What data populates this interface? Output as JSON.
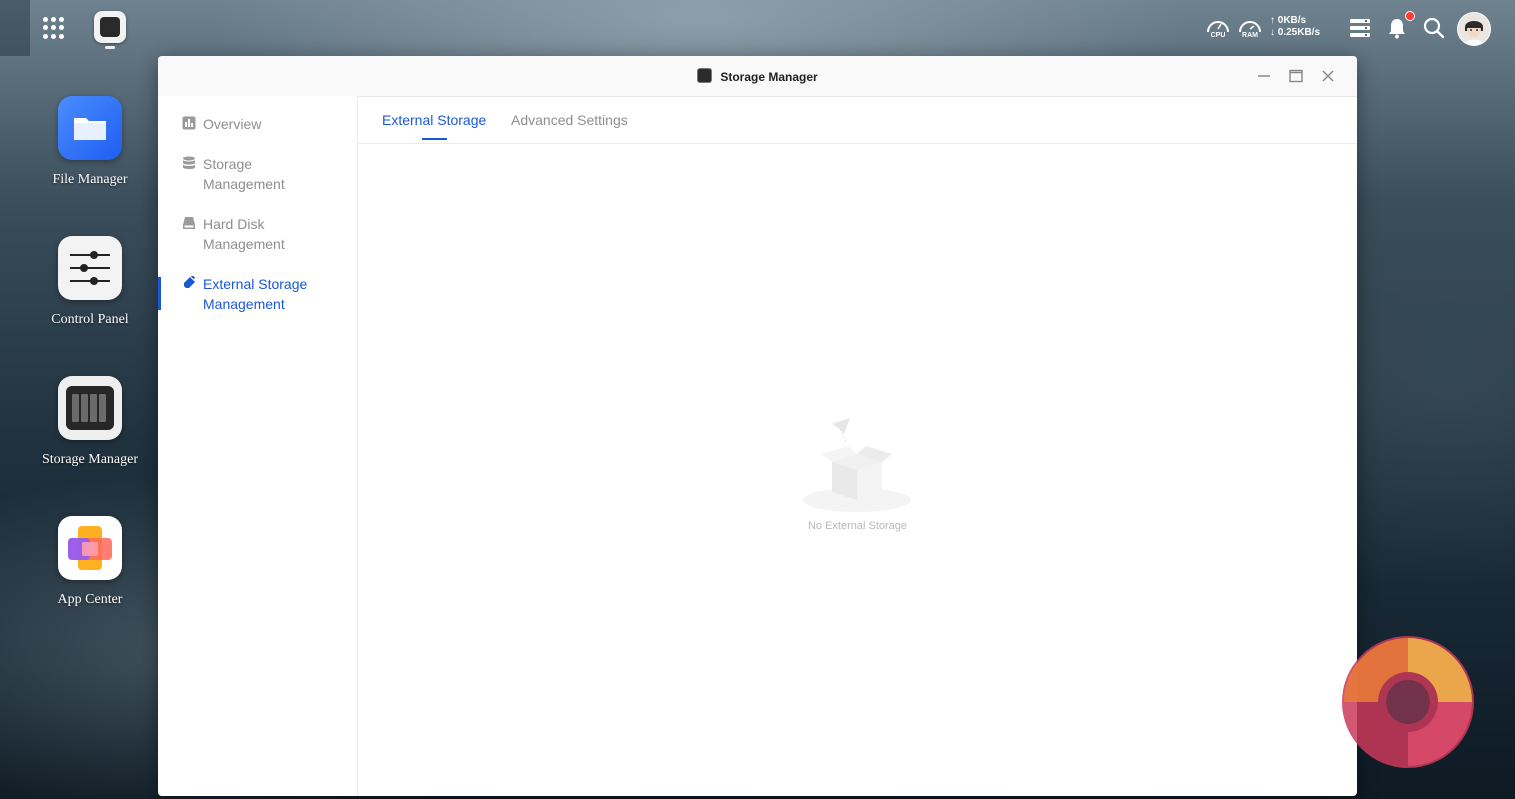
{
  "taskbar": {
    "cpu_label": "CPU",
    "ram_label": "RAM",
    "upload_speed": "↑ 0KB/s",
    "download_speed": "↓ 0.25KB/s"
  },
  "desktop": {
    "icons": [
      {
        "label": "File Manager"
      },
      {
        "label": "Control Panel"
      },
      {
        "label": "Storage Manager"
      },
      {
        "label": "App Center"
      }
    ]
  },
  "window": {
    "title": "Storage Manager"
  },
  "sidebar": {
    "items": [
      {
        "label": "Overview"
      },
      {
        "label": "Storage\nManagement"
      },
      {
        "label": "Hard Disk\nManagement"
      },
      {
        "label": "External Storage\nManagement"
      }
    ]
  },
  "main": {
    "tabs": [
      {
        "label": "External Storage"
      },
      {
        "label": "Advanced Settings"
      }
    ],
    "empty_text": "No External Storage"
  },
  "colors": {
    "accent": "#1a57d8",
    "muted_text": "#8e8e8e",
    "notification": "#ff3b30"
  }
}
